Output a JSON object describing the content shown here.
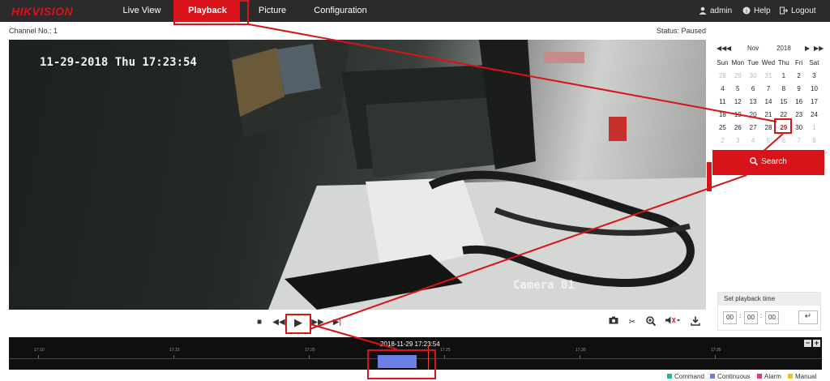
{
  "brand": {
    "logo": "HIKVISION"
  },
  "nav": {
    "tabs": [
      {
        "label": "Live View",
        "active": false
      },
      {
        "label": "Playback",
        "active": true
      },
      {
        "label": "Picture",
        "active": false
      },
      {
        "label": "Configuration",
        "active": false
      }
    ],
    "user": "admin",
    "help": "Help",
    "logout": "Logout"
  },
  "header": {
    "channel": "Channel No.: 1",
    "status": "Status: Paused"
  },
  "video": {
    "osd_datetime": "11-29-2018 Thu 17:23:54",
    "osd_camera": "Camera 01"
  },
  "controls": {
    "icons": [
      "stop-icon",
      "slow-down-icon",
      "play-icon",
      "fast-forward-icon",
      "single-frame-icon",
      "capture-icon",
      "clip-icon",
      "digital-zoom-icon",
      "audio-icon",
      "download-icon"
    ]
  },
  "calendar": {
    "month": "Nov",
    "year": "2018",
    "weekdays": [
      "Sun",
      "Mon",
      "Tue",
      "Wed",
      "Thu",
      "Fri",
      "Sat"
    ],
    "weeks": [
      [
        "28",
        "29",
        "30",
        "31",
        "1",
        "2",
        "3"
      ],
      [
        "4",
        "5",
        "6",
        "7",
        "8",
        "9",
        "10"
      ],
      [
        "11",
        "12",
        "13",
        "14",
        "15",
        "16",
        "17"
      ],
      [
        "18",
        "19",
        "20",
        "21",
        "22",
        "23",
        "24"
      ],
      [
        "25",
        "26",
        "27",
        "28",
        "29",
        "30",
        "1"
      ],
      [
        "2",
        "3",
        "4",
        "5",
        "6",
        "7",
        "8"
      ]
    ],
    "selected": "29"
  },
  "search": {
    "label": "Search"
  },
  "playback_time": {
    "title": "Set playback time",
    "hh": "00",
    "mm": "00",
    "ss": "00",
    "go_icon": "enter-icon"
  },
  "timeline": {
    "current": "2018-11-29 17:23:54",
    "ticks": [
      "17:10",
      "17:15",
      "17:20",
      "17:25",
      "17:30",
      "17:35"
    ],
    "zoom_out": "−",
    "zoom_in": "+"
  },
  "legend": [
    {
      "label": "Command",
      "color": "#1fb59a"
    },
    {
      "label": "Continuous",
      "color": "#6c7fe6"
    },
    {
      "label": "Alarm",
      "color": "#e23d7a"
    },
    {
      "label": "Manual",
      "color": "#f0c21a"
    }
  ],
  "colors": {
    "accent": "#d8131a",
    "topbar": "#2b2b2b"
  }
}
